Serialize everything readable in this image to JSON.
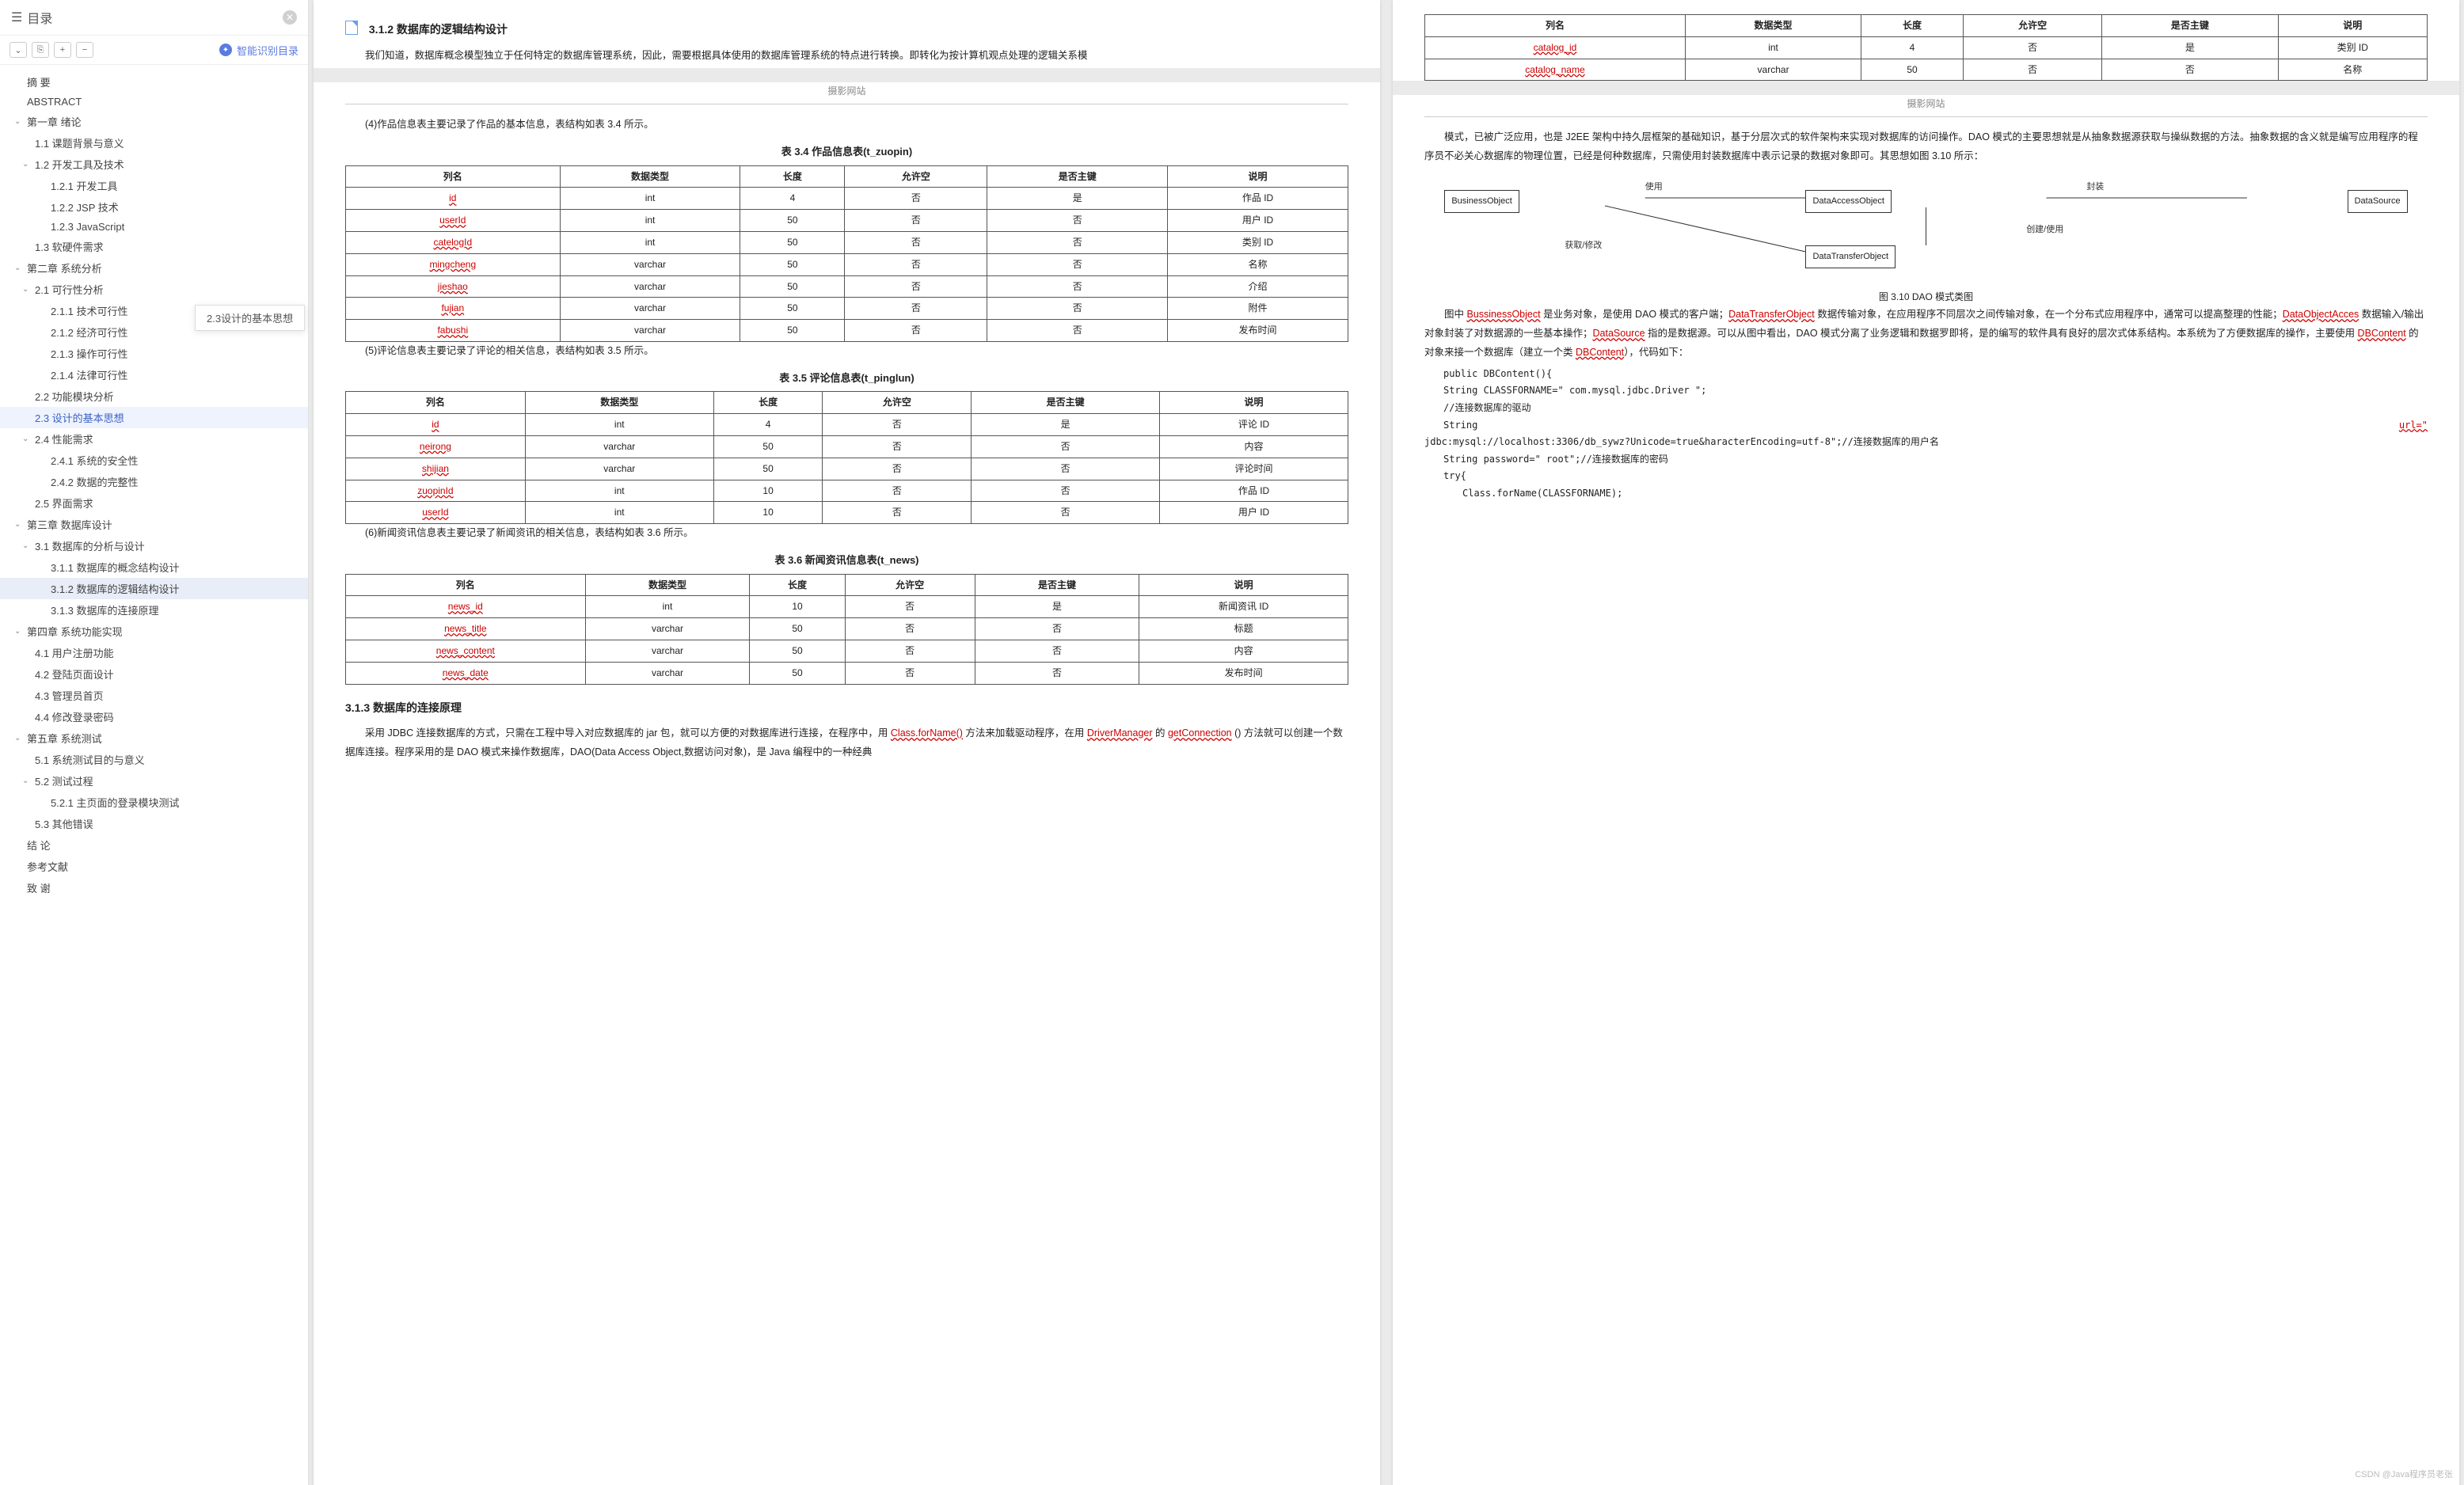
{
  "sidebar": {
    "title": "目录",
    "smart_toc_label": "智能识别目录",
    "toolbar": {
      "expand_all": "⌄",
      "locate": "⎘",
      "zoom_in": "+",
      "zoom_out": "−"
    },
    "items": [
      {
        "label": "摘  要",
        "depth": 0,
        "caret": false
      },
      {
        "label": "ABSTRACT",
        "depth": 0,
        "caret": false
      },
      {
        "label": "第一章  绪论",
        "depth": 0,
        "caret": true
      },
      {
        "label": "1.1 课题背景与意义",
        "depth": 1,
        "caret": false
      },
      {
        "label": "1.2 开发工具及技术",
        "depth": 1,
        "caret": true
      },
      {
        "label": "1.2.1 开发工具",
        "depth": 2,
        "caret": false
      },
      {
        "label": "1.2.2 JSP 技术",
        "depth": 2,
        "caret": false
      },
      {
        "label": "1.2.3 JavaScript",
        "depth": 2,
        "caret": false
      },
      {
        "label": "1.3 软硬件需求",
        "depth": 1,
        "caret": false
      },
      {
        "label": "第二章  系统分析",
        "depth": 0,
        "caret": true
      },
      {
        "label": "2.1 可行性分析",
        "depth": 1,
        "caret": true
      },
      {
        "label": "2.1.1 技术可行性",
        "depth": 2,
        "caret": false
      },
      {
        "label": "2.1.2 经济可行性",
        "depth": 2,
        "caret": false
      },
      {
        "label": "2.1.3 操作可行性",
        "depth": 2,
        "caret": false
      },
      {
        "label": "2.1.4 法律可行性",
        "depth": 2,
        "caret": false
      },
      {
        "label": "2.2 功能模块分析",
        "depth": 1,
        "caret": false
      },
      {
        "label": "2.3 设计的基本思想",
        "depth": 1,
        "caret": false,
        "active": true
      },
      {
        "label": "2.4 性能需求",
        "depth": 1,
        "caret": true
      },
      {
        "label": "2.4.1 系统的安全性",
        "depth": 2,
        "caret": false
      },
      {
        "label": "2.4.2 数据的完整性",
        "depth": 2,
        "caret": false
      },
      {
        "label": "2.5 界面需求",
        "depth": 1,
        "caret": false
      },
      {
        "label": "第三章  数据库设计",
        "depth": 0,
        "caret": true
      },
      {
        "label": "3.1 数据库的分析与设计",
        "depth": 1,
        "caret": true
      },
      {
        "label": "3.1.1 数据库的概念结构设计",
        "depth": 2,
        "caret": false
      },
      {
        "label": "3.1.2 数据库的逻辑结构设计",
        "depth": 2,
        "caret": false,
        "selected": true
      },
      {
        "label": "3.1.3 数据库的连接原理",
        "depth": 2,
        "caret": false
      },
      {
        "label": "第四章  系统功能实现",
        "depth": 0,
        "caret": true
      },
      {
        "label": "4.1 用户注册功能",
        "depth": 1,
        "caret": false
      },
      {
        "label": "4.2 登陆页面设计",
        "depth": 1,
        "caret": false
      },
      {
        "label": "4.3 管理员首页",
        "depth": 1,
        "caret": false
      },
      {
        "label": "4.4 修改登录密码",
        "depth": 1,
        "caret": false
      },
      {
        "label": "第五章  系统测试",
        "depth": 0,
        "caret": true
      },
      {
        "label": "5.1 系统测试目的与意义",
        "depth": 1,
        "caret": false
      },
      {
        "label": "5.2 测试过程",
        "depth": 1,
        "caret": true
      },
      {
        "label": "5.2.1 主页面的登录模块测试",
        "depth": 2,
        "caret": false
      },
      {
        "label": "5.3 其他错误",
        "depth": 1,
        "caret": false
      },
      {
        "label": "结  论",
        "depth": 0,
        "caret": false
      },
      {
        "label": "参考文献",
        "depth": 0,
        "caret": false
      },
      {
        "label": "致  谢",
        "depth": 0,
        "caret": false
      }
    ],
    "tooltip": "2.3设计的基本思想"
  },
  "left_page": {
    "section312_title": "3.1.2 数据库的逻辑结构设计",
    "section312_p1": "我们知道，数据库概念模型独立于任何特定的数据库管理系统，因此，需要根据具体使用的数据库管理系统的特点进行转换。即转化为按计算机观点处理的逻辑关系模",
    "header": "摄影网站",
    "t34_intro": "(4)作品信息表主要记录了作品的基本信息，表结构如表 3.4 所示。",
    "t34_caption": "表 3.4 作品信息表(t_zuopin)",
    "t35_intro": "(5)评论信息表主要记录了评论的相关信息，表结构如表 3.5 所示。",
    "t35_caption": "表 3.5 评论信息表(t_pinglun)",
    "t36_intro": "(6)新闻资讯信息表主要记录了新闻资讯的相关信息，表结构如表 3.6 所示。",
    "t36_caption": "表 3.6 新闻资讯信息表(t_news)",
    "section313_title": "3.1.3 数据库的连接原理",
    "section313_p1_a": "采用 JDBC 连接数据库的方式，只需在工程中导入对应数据库的 jar 包，就可以方便的对数据库进行连接，在程序中，用 ",
    "section313_p1_b": " 方法来加载驱动程序，在用 ",
    "section313_p1_c": " 的 ",
    "section313_p1_d": " () 方法就可以创建一个数据库连接。程序采用的是 DAO 模式来操作数据库，DAO(Data Access Object,数据访问对象)，是 Java 编程中的一种经典",
    "ul1": "Class.forName()",
    "ul2": "DriverManager",
    "ul3": "getConnection"
  },
  "right_page": {
    "header": "摄影网站",
    "p1_a": "模式，已被广泛应用，也是 J2EE 架构中持久层框架的基础知识，基于分层次式的软件架构来实现对数据库的访问操作。DAO 模式的主要思想就是从抽象数据源获取与操纵数据的方法。抽象数据的含义就是编写应用程序的程序员不必关心数据库的物理位置，已经是何种数据库，只需使用封装数据库中表示记录的数据对象即可。其思想如图 3.10 所示：",
    "diagram": {
      "b1": "BusinessObject",
      "b2": "DataAccessObject",
      "b3": "DataSource",
      "b4": "DataTransferObject",
      "l1": "使用",
      "l2": "封装",
      "l3": "创建/使用",
      "l4": "获取/修改",
      "caption": "图 3.10  DAO 模式类图"
    },
    "p2_a": "图中 ",
    "ul_bo": "BussinessObject",
    "p2_b": " 是业务对象，是使用 DAO 模式的客户端；",
    "ul_dto": "DataTransferObject",
    "p2_c": " 数据传输对象，在应用程序不同层次之间传输对象，在一个分布式应用程序中，通常可以提高整理的性能；",
    "ul_dao": "DataObjectAcces",
    "p2_d": " 数据输入/输出对象封装了对数据源的一些基本操作；",
    "ul_ds": "DataSource",
    "p2_e": " 指的是数据源。可以从图中看出，DAO 模式分离了业务逻辑和数据罗即将，是的编写的软件具有良好的层次式体系结构。本系统为了方便数据库的操作，主要使用 ",
    "ul_dbc": "DBContent",
    "p2_f": " 的对象来接一个数据库（建立一个类 ",
    "ul_dbc2": "DBContent",
    "p2_g": "），代码如下：",
    "code": {
      "l1": "public DBContent(){",
      "l2": "String CLASSFORNAME=\" com.mysql.jdbc.Driver \";",
      "l3": "//连接数据库的驱动",
      "l4a": "String",
      "l4b": "url=\"",
      "l5": "jdbc:mysql://localhost:3306/db_sywz?Unicode=true&haracterEncoding=utf-8\";//连接数据库的用户名",
      "l6": "String password=\" root\";//连接数据库的密码",
      "l7": "try{",
      "l8": "Class.forName(CLASSFORNAME);"
    }
  },
  "tables": {
    "headers": [
      "列名",
      "数据类型",
      "长度",
      "允许空",
      "是否主键",
      "说明"
    ],
    "top_right": [
      [
        "catalog_id",
        "int",
        "4",
        "否",
        "是",
        "类别 ID"
      ],
      [
        "catalog_name",
        "varchar",
        "50",
        "否",
        "否",
        "名称"
      ]
    ],
    "t34": [
      [
        "id",
        "int",
        "4",
        "否",
        "是",
        "作品 ID"
      ],
      [
        "userId",
        "int",
        "50",
        "否",
        "否",
        "用户 ID"
      ],
      [
        "catelogId",
        "int",
        "50",
        "否",
        "否",
        "类别 ID"
      ],
      [
        "mingcheng",
        "varchar",
        "50",
        "否",
        "否",
        "名称"
      ],
      [
        "jieshao",
        "varchar",
        "50",
        "否",
        "否",
        "介绍"
      ],
      [
        "fujian",
        "varchar",
        "50",
        "否",
        "否",
        "附件"
      ],
      [
        "fabushi",
        "varchar",
        "50",
        "否",
        "否",
        "发布时间"
      ]
    ],
    "t35": [
      [
        "id",
        "int",
        "4",
        "否",
        "是",
        "评论 ID"
      ],
      [
        "neirong",
        "varchar",
        "50",
        "否",
        "否",
        "内容"
      ],
      [
        "shijian",
        "varchar",
        "50",
        "否",
        "否",
        "评论时间"
      ],
      [
        "zuopinId",
        "int",
        "10",
        "否",
        "否",
        "作品 ID"
      ],
      [
        "userId",
        "int",
        "10",
        "否",
        "否",
        "用户 ID"
      ]
    ],
    "t36": [
      [
        "news_id",
        "int",
        "10",
        "否",
        "是",
        "新闻资讯 ID"
      ],
      [
        "news_title",
        "varchar",
        "50",
        "否",
        "否",
        "标题"
      ],
      [
        "news_content",
        "varchar",
        "50",
        "否",
        "否",
        "内容"
      ],
      [
        "news_date",
        "varchar",
        "50",
        "否",
        "否",
        "发布时间"
      ]
    ]
  },
  "watermark": "CSDN @Java程序员老张"
}
